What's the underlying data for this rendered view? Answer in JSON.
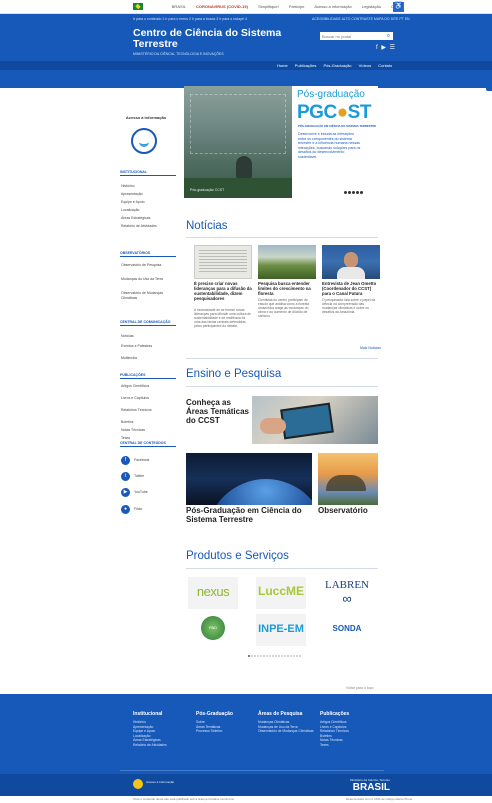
{
  "govbar": {
    "brasil": "BRASIL",
    "links": [
      "CORONAVÍRUS (COVID-19)",
      "Simplifique!",
      "Participe",
      "Acesso à informação",
      "Legislação",
      "Canais"
    ],
    "accessibility_icon": "accessibility-icon"
  },
  "header": {
    "top_strip": "Ir para o conteúdo 1   Ir para o menu 2   Ir para a busca 3   Ir para o rodapé 4",
    "right_strip": "ACESSIBILIDADE   ALTO CONTRASTE   MAPA DO SITE   PT   EN",
    "title": "Centro de Ciência do Sistema Terrestre",
    "subtitle": "Ministério da Ciência, Tecnologia e Inovações",
    "search_placeholder": "Buscar no portal",
    "nav": [
      "Home",
      "Publicações",
      "Pós-Graduação",
      "Vídeos",
      "Contato"
    ]
  },
  "sidebar": {
    "access_info": "Acesso à Informação",
    "institutional": {
      "heading": "INSTITUCIONAL",
      "items": [
        "Histórico",
        "Apresentação",
        "Equipe e Apoio",
        "Localização",
        "Áreas Estratégicas",
        "Relatório de Atividades"
      ]
    },
    "observatories": {
      "heading": "OBSERVATÓRIOS",
      "items": [
        "Observatório de Pesquisa",
        "Mudanças do Uso da Terra",
        "Observatório de Mudanças Climáticas"
      ]
    },
    "communication": {
      "heading": "CENTRAL DE COMUNICAÇÃO",
      "items": [
        "Notícias",
        "Eventos e Palestras",
        "Multimídia"
      ]
    },
    "publications": {
      "heading": "PUBLICAÇÕES",
      "items": [
        "Artigos Científicos",
        "Livros e Capítulos",
        "Relatórios Técnicos",
        "Boletins",
        "Notas Técnicas",
        "Teses"
      ]
    },
    "channels": {
      "heading": "CENTRAL DE CONTEÚDOS",
      "items": [
        "Facebook",
        "Twitter",
        "YouTube",
        "Flickr"
      ]
    }
  },
  "banner": {
    "pg_line1": "Pós-graduação",
    "pg_logo_a": "PGC",
    "pg_logo_b": "ST",
    "pg_line3": "PÓS-GRADUAÇÃO EM CIÊNCIA DO SISTEMA TERRESTRE",
    "pg_text": "Desenvolve e estuda as interações entre os componentes do sistema terrestre e a influência humana nessas interações, buscando soluções para os desafios do desenvolvimento sustentável.",
    "caption": "Pós-graduação CCST"
  },
  "news": {
    "heading": "Notícias",
    "items": [
      {
        "title": "É preciso criar novas lideranças para a difusão da sustentabilidade, dizem pesquisadores",
        "desc": "A necessidade de se formar novas lideranças para difundir uma cultura de sustentabilidade e de resiliência foi uma das ideias centrais defendidas pelos participantes do debate."
      },
      {
        "title": "Pesquisa busca entender limites do crescimento na floresta",
        "desc": "Cientistas do centro participam de estudo que analisa como a floresta amazônica reage às mudanças do clima e ao aumento de dióxido de carbono."
      },
      {
        "title": "Entrevista de Jean Ometto (Coordenador do CCST) para o Canal Futura",
        "desc": "O pesquisador fala sobre o papel da ciência na compreensão das mudanças climáticas e sobre os desafios da Amazônia."
      }
    ],
    "more": "Mais Notícias"
  },
  "teaching": {
    "heading": "Ensino e Pesquisa",
    "themes": "Conheça as Áreas Temáticas do CCST",
    "postgrad": "Pós-Graduação em Ciência do Sistema Terrestre",
    "observatory": "Observatório"
  },
  "products": {
    "heading": "Produtos e Serviços",
    "items": [
      "nexus",
      "LuccME",
      "LABREN",
      "PAD",
      "INPE-EM",
      "SONDA"
    ]
  },
  "back_to_top": "Voltar para o topo",
  "footer": {
    "cols": [
      {
        "heading": "Institucional",
        "items": [
          "Histórico",
          "Apresentação",
          "Equipe e Apoio",
          "Localização",
          "Áreas Estratégicas",
          "Relatório de Atividades"
        ]
      },
      {
        "heading": "Pós-Graduação",
        "items": [
          "Sobre",
          "Áreas Temáticas",
          "Processo Seletivo"
        ]
      },
      {
        "heading": "Áreas de Pesquisa",
        "items": [
          "Mudanças Climáticas",
          "Mudanças de Uso da Terra",
          "Observatório de Mudanças Climáticas"
        ]
      },
      {
        "heading": "Publicações",
        "items": [
          "Artigos Científicos",
          "Livros e Capítulos",
          "Relatórios Técnicos",
          "Boletins",
          "Notas Técnicas",
          "Teses"
        ]
      }
    ],
    "access_text": "Acesso à Informação",
    "ministry": "Ministério da Ciência, Tecnologia e Inovações",
    "brasil": "BRASIL",
    "bottom_left": "Todo o conteúdo deste site está publicado sob a licença Creative Commons",
    "bottom_right": "Desenvolvido com o CMS de código aberto Plone"
  }
}
